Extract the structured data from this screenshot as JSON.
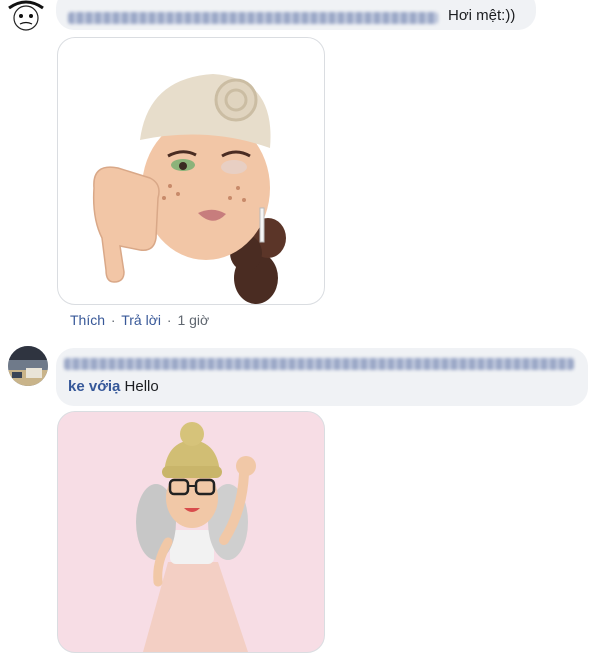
{
  "comments": [
    {
      "reply_text": "Hơi mệt:))",
      "actions": {
        "like": "Thích",
        "reply": "Trả lời",
        "time": "1 giờ",
        "separator": "·"
      }
    },
    {
      "name_visible": "ke với",
      "tag_text": "ạ",
      "reply_text": "Hello"
    }
  ],
  "colors": {
    "bubble_bg": "#f0f2f5",
    "link_blue": "#385898",
    "sticker2_bg": "#f7dde5"
  }
}
